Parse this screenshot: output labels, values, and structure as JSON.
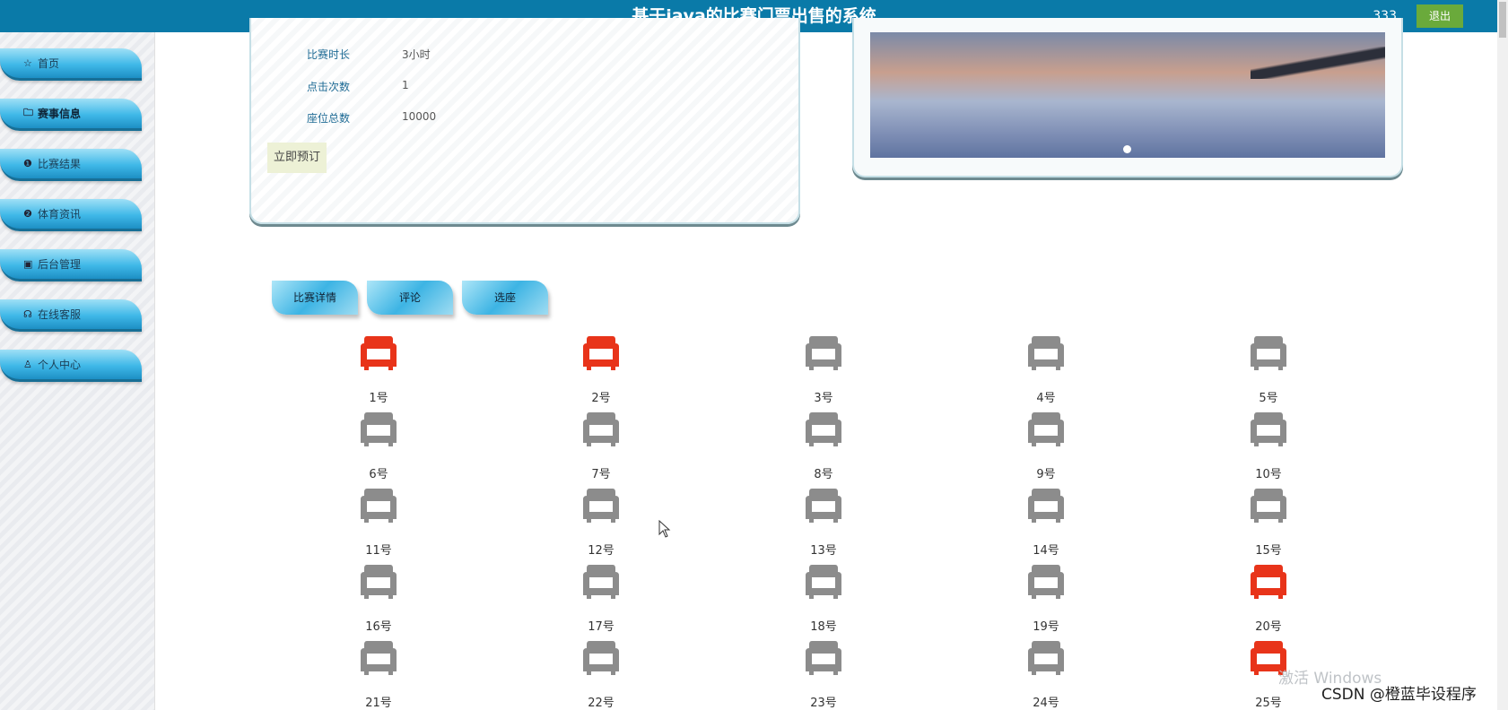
{
  "header": {
    "title": "基于java的比赛门票出售的系统",
    "user": "333",
    "logout_label": "退出"
  },
  "sidebar": {
    "items": [
      {
        "label": "首页",
        "icon": "☆"
      },
      {
        "label": "赛事信息",
        "icon": "🗀"
      },
      {
        "label": "比赛结果",
        "icon": "❶"
      },
      {
        "label": "体育资讯",
        "icon": "❷"
      },
      {
        "label": "后台管理",
        "icon": "▣"
      },
      {
        "label": "在线客服",
        "icon": "☊"
      },
      {
        "label": "个人中心",
        "icon": "♙"
      }
    ]
  },
  "details": {
    "rows": [
      {
        "key": "比赛时长",
        "value": "3小时"
      },
      {
        "key": "点击次数",
        "value": "1"
      },
      {
        "key": "座位总数",
        "value": "10000"
      }
    ],
    "book_label": "立即预订"
  },
  "tabs": [
    "比赛详情",
    "评论",
    "选座"
  ],
  "seat_colors": {
    "taken": "#e8341a",
    "free": "#8c8c8c"
  },
  "seats": [
    {
      "label": "1号",
      "taken": true
    },
    {
      "label": "2号",
      "taken": true
    },
    {
      "label": "3号",
      "taken": false
    },
    {
      "label": "4号",
      "taken": false
    },
    {
      "label": "5号",
      "taken": false
    },
    {
      "label": "6号",
      "taken": false
    },
    {
      "label": "7号",
      "taken": false
    },
    {
      "label": "8号",
      "taken": false
    },
    {
      "label": "9号",
      "taken": false
    },
    {
      "label": "10号",
      "taken": false
    },
    {
      "label": "11号",
      "taken": false
    },
    {
      "label": "12号",
      "taken": false
    },
    {
      "label": "13号",
      "taken": false
    },
    {
      "label": "14号",
      "taken": false
    },
    {
      "label": "15号",
      "taken": false
    },
    {
      "label": "16号",
      "taken": false
    },
    {
      "label": "17号",
      "taken": false
    },
    {
      "label": "18号",
      "taken": false
    },
    {
      "label": "19号",
      "taken": false
    },
    {
      "label": "20号",
      "taken": true
    },
    {
      "label": "21号",
      "taken": false
    },
    {
      "label": "22号",
      "taken": false
    },
    {
      "label": "23号",
      "taken": false
    },
    {
      "label": "24号",
      "taken": false
    },
    {
      "label": "25号",
      "taken": true
    }
  ],
  "overlay": {
    "windows_watermark": "激活 Windows",
    "csdn": "CSDN @橙蓝毕设程序"
  }
}
